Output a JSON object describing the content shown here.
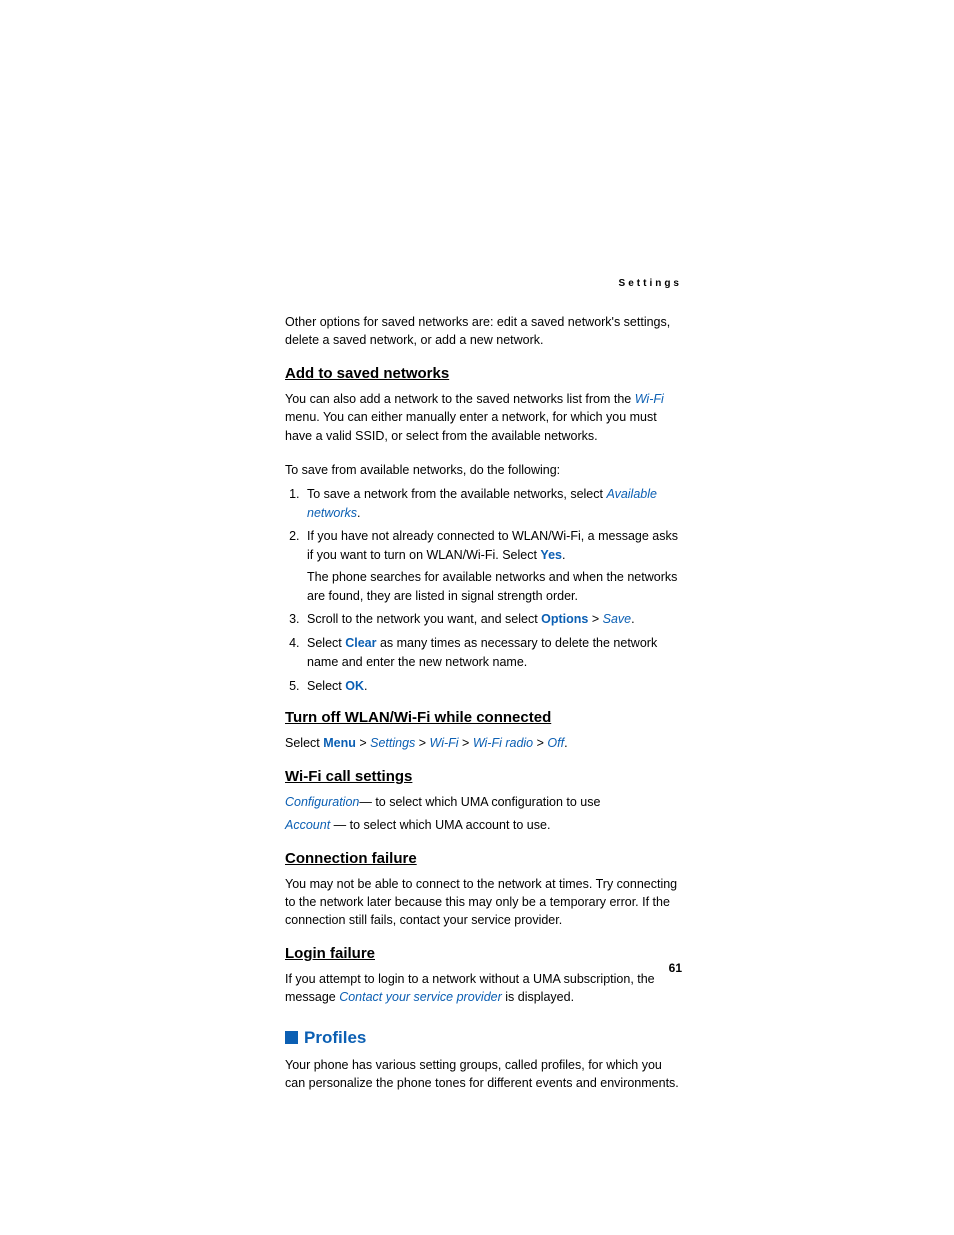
{
  "header": {
    "label": "Settings"
  },
  "intro_paragraph": "Other options for saved networks are: edit a saved network's settings, delete a saved network, or add a new network.",
  "sections": {
    "add_to_saved": {
      "heading": "Add to saved networks",
      "p1_a": "You can also add a network to the saved networks list from the ",
      "p1_link": "Wi-Fi",
      "p1_b": " menu. You can either manually enter a network, for which you must have a valid SSID, or select from the available networks.",
      "p2": "To save from available networks, do the following:",
      "steps": {
        "s1_a": "To save a network from the available networks, select ",
        "s1_link": "Available networks",
        "s1_b": ".",
        "s2_a": "If you have not already connected to WLAN/Wi-Fi, a message asks if you want to turn on WLAN/Wi-Fi. Select ",
        "s2_link": "Yes",
        "s2_b": ".",
        "s2_sub": "The phone searches for available networks and when the networks are found, they are listed in signal strength order.",
        "s3_a": "Scroll to the network you want, and select ",
        "s3_link1": "Options",
        "s3_gt": " > ",
        "s3_link2": "Save",
        "s3_b": ".",
        "s4_a": "Select ",
        "s4_link": "Clear",
        "s4_b": " as many times as necessary to delete the network name and enter the new network name.",
        "s5_a": "Select ",
        "s5_link": "OK",
        "s5_b": "."
      }
    },
    "turn_off": {
      "heading": "Turn off WLAN/Wi-Fi while connected",
      "select_label": "Select ",
      "menu": "Menu",
      "gt1": " > ",
      "settings": "Settings",
      "gt2": " > ",
      "wifi": "Wi-Fi",
      "gt3": " > ",
      "wifi_radio": "Wi-Fi radio",
      "gt4": " > ",
      "off": "Off",
      "period": "."
    },
    "wifi_call": {
      "heading": "Wi-Fi call settings",
      "conf_link": "Configuration",
      "conf_text": "— to select which UMA configuration to use",
      "acct_link": "Account",
      "acct_text": " — to select which UMA account to use."
    },
    "conn_fail": {
      "heading": "Connection failure",
      "text": "You may not be able to connect to the network at times. Try connecting to the network later because this may only be a temporary error. If the connection still fails, contact your service provider."
    },
    "login_fail": {
      "heading": "Login failure",
      "p_a": "If you attempt to login to a network without a UMA subscription, the message ",
      "p_link": "Contact your service provider",
      "p_b": " is displayed."
    },
    "profiles": {
      "heading": "Profiles",
      "text": "Your phone has various setting groups, called profiles, for which you can personalize the phone tones for different events and environments."
    }
  },
  "page_number": "61"
}
